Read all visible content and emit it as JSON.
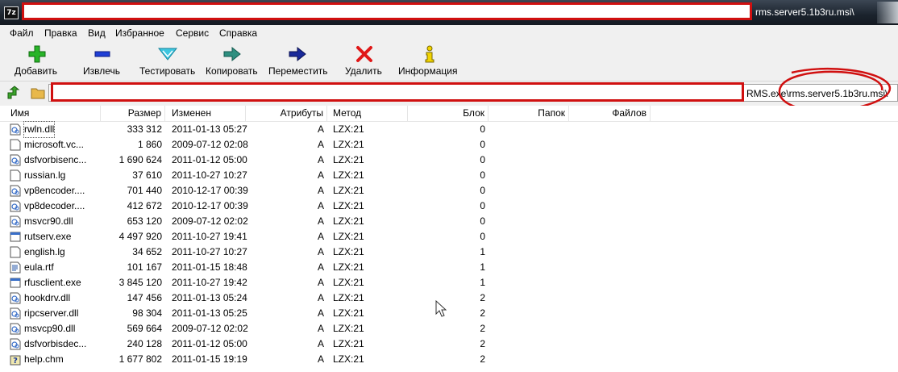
{
  "window": {
    "title_visible": "rms.server5.1b3ru.msi\\",
    "app_icon_text": "7z"
  },
  "menu": [
    "Файл",
    "Правка",
    "Вид",
    "Избранное",
    "Сервис",
    "Справка"
  ],
  "toolbar": {
    "add": "Добавить",
    "extract": "Извлечь",
    "test": "Тестировать",
    "copy": "Копировать",
    "move": "Переместить",
    "delete": "Удалить",
    "info": "Информация"
  },
  "address": {
    "visible_path": "RMS.exe\\rms.server5.1b3ru.msi\\"
  },
  "columns": [
    "Имя",
    "Размер",
    "Изменен",
    "Атрибуты",
    "Метод",
    "Блок",
    "Папок",
    "Файлов"
  ],
  "files": [
    {
      "name": "rwln.dll",
      "size": "333 312",
      "modified": "2011-01-13 05:27",
      "attr": "A",
      "method": "LZX:21",
      "block": "0",
      "icon": "dll-icon"
    },
    {
      "name": "microsoft.vc...",
      "size": "1 860",
      "modified": "2009-07-12 02:08",
      "attr": "A",
      "method": "LZX:21",
      "block": "0",
      "icon": "file-icon"
    },
    {
      "name": "dsfvorbisenc...",
      "size": "1 690 624",
      "modified": "2011-01-12 05:00",
      "attr": "A",
      "method": "LZX:21",
      "block": "0",
      "icon": "dll-icon"
    },
    {
      "name": "russian.lg",
      "size": "37 610",
      "modified": "2011-10-27 10:27",
      "attr": "A",
      "method": "LZX:21",
      "block": "0",
      "icon": "file-icon"
    },
    {
      "name": "vp8encoder....",
      "size": "701 440",
      "modified": "2010-12-17 00:39",
      "attr": "A",
      "method": "LZX:21",
      "block": "0",
      "icon": "dll-icon"
    },
    {
      "name": "vp8decoder....",
      "size": "412 672",
      "modified": "2010-12-17 00:39",
      "attr": "A",
      "method": "LZX:21",
      "block": "0",
      "icon": "dll-icon"
    },
    {
      "name": "msvcr90.dll",
      "size": "653 120",
      "modified": "2009-07-12 02:02",
      "attr": "A",
      "method": "LZX:21",
      "block": "0",
      "icon": "dll-icon"
    },
    {
      "name": "rutserv.exe",
      "size": "4 497 920",
      "modified": "2011-10-27 19:41",
      "attr": "A",
      "method": "LZX:21",
      "block": "0",
      "icon": "exe-icon"
    },
    {
      "name": "english.lg",
      "size": "34 652",
      "modified": "2011-10-27 10:27",
      "attr": "A",
      "method": "LZX:21",
      "block": "1",
      "icon": "file-icon"
    },
    {
      "name": "eula.rtf",
      "size": "101 167",
      "modified": "2011-01-15 18:48",
      "attr": "A",
      "method": "LZX:21",
      "block": "1",
      "icon": "rtf-icon"
    },
    {
      "name": "rfusclient.exe",
      "size": "3 845 120",
      "modified": "2011-10-27 19:42",
      "attr": "A",
      "method": "LZX:21",
      "block": "1",
      "icon": "exe-icon"
    },
    {
      "name": "hookdrv.dll",
      "size": "147 456",
      "modified": "2011-01-13 05:24",
      "attr": "A",
      "method": "LZX:21",
      "block": "2",
      "icon": "dll-icon"
    },
    {
      "name": "ripcserver.dll",
      "size": "98 304",
      "modified": "2011-01-13 05:25",
      "attr": "A",
      "method": "LZX:21",
      "block": "2",
      "icon": "dll-icon"
    },
    {
      "name": "msvcp90.dll",
      "size": "569 664",
      "modified": "2009-07-12 02:02",
      "attr": "A",
      "method": "LZX:21",
      "block": "2",
      "icon": "dll-icon"
    },
    {
      "name": "dsfvorbisdec...",
      "size": "240 128",
      "modified": "2011-01-12 05:00",
      "attr": "A",
      "method": "LZX:21",
      "block": "2",
      "icon": "dll-icon"
    },
    {
      "name": "help.chm",
      "size": "1 677 802",
      "modified": "2011-01-15 19:19",
      "attr": "A",
      "method": "LZX:21",
      "block": "2",
      "icon": "chm-icon"
    }
  ],
  "colors": {
    "redaction": "#d01010",
    "titlebar": "#1b232d",
    "chrome": "#f0f0f0"
  }
}
